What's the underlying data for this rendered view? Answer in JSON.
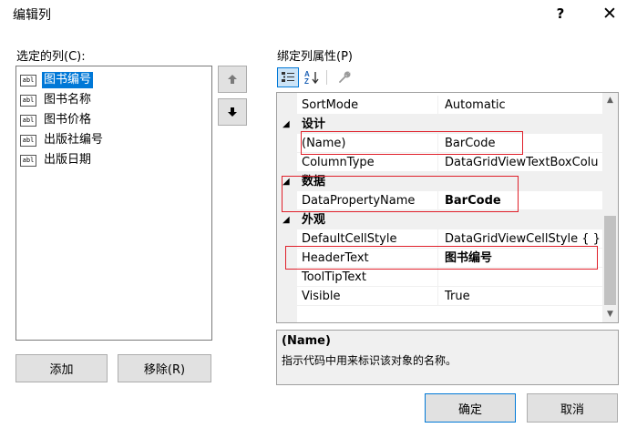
{
  "window": {
    "title": "编辑列",
    "help": "?",
    "close": "✕"
  },
  "left": {
    "label": "选定的列(C):",
    "items": [
      {
        "label": "图书编号",
        "icon": "abl"
      },
      {
        "label": "图书名称",
        "icon": "abl"
      },
      {
        "label": "图书价格",
        "icon": "abl"
      },
      {
        "label": "出版社编号",
        "icon": "abl"
      },
      {
        "label": "出版日期",
        "icon": "abl"
      }
    ],
    "selected_index": 0,
    "add_label": "添加",
    "remove_label": "移除(R)"
  },
  "right": {
    "label": "绑定列属性(P)",
    "rows": [
      {
        "type": "prop",
        "name": "SortMode",
        "value": "Automatic"
      },
      {
        "type": "cat",
        "name": "设计"
      },
      {
        "type": "prop",
        "name": "(Name)",
        "value": "BarCode"
      },
      {
        "type": "prop",
        "name": "ColumnType",
        "value": "DataGridViewTextBoxColu"
      },
      {
        "type": "cat",
        "name": "数据"
      },
      {
        "type": "prop",
        "name": "DataPropertyName",
        "value": "BarCode",
        "bold": true
      },
      {
        "type": "cat",
        "name": "外观"
      },
      {
        "type": "prop",
        "name": "DefaultCellStyle",
        "value": "DataGridViewCellStyle { }"
      },
      {
        "type": "prop",
        "name": "HeaderText",
        "value": "图书编号",
        "bold": true
      },
      {
        "type": "prop",
        "name": "ToolTipText",
        "value": ""
      },
      {
        "type": "prop",
        "name": "Visible",
        "value": "True"
      }
    ],
    "description": {
      "title": "(Name)",
      "text": "指示代码中用来标识该对象的名称。"
    }
  },
  "footer": {
    "ok_label": "确定",
    "cancel_label": "取消"
  },
  "icons": {
    "move_up": "up-arrow-icon",
    "move_down": "down-arrow-icon",
    "categorized": "categorized-icon",
    "alphabetical": "alphabetical-icon",
    "property_pages": "wrench-icon"
  },
  "colors": {
    "selection": "#0078d7",
    "highlight_box": "#e0202a"
  }
}
